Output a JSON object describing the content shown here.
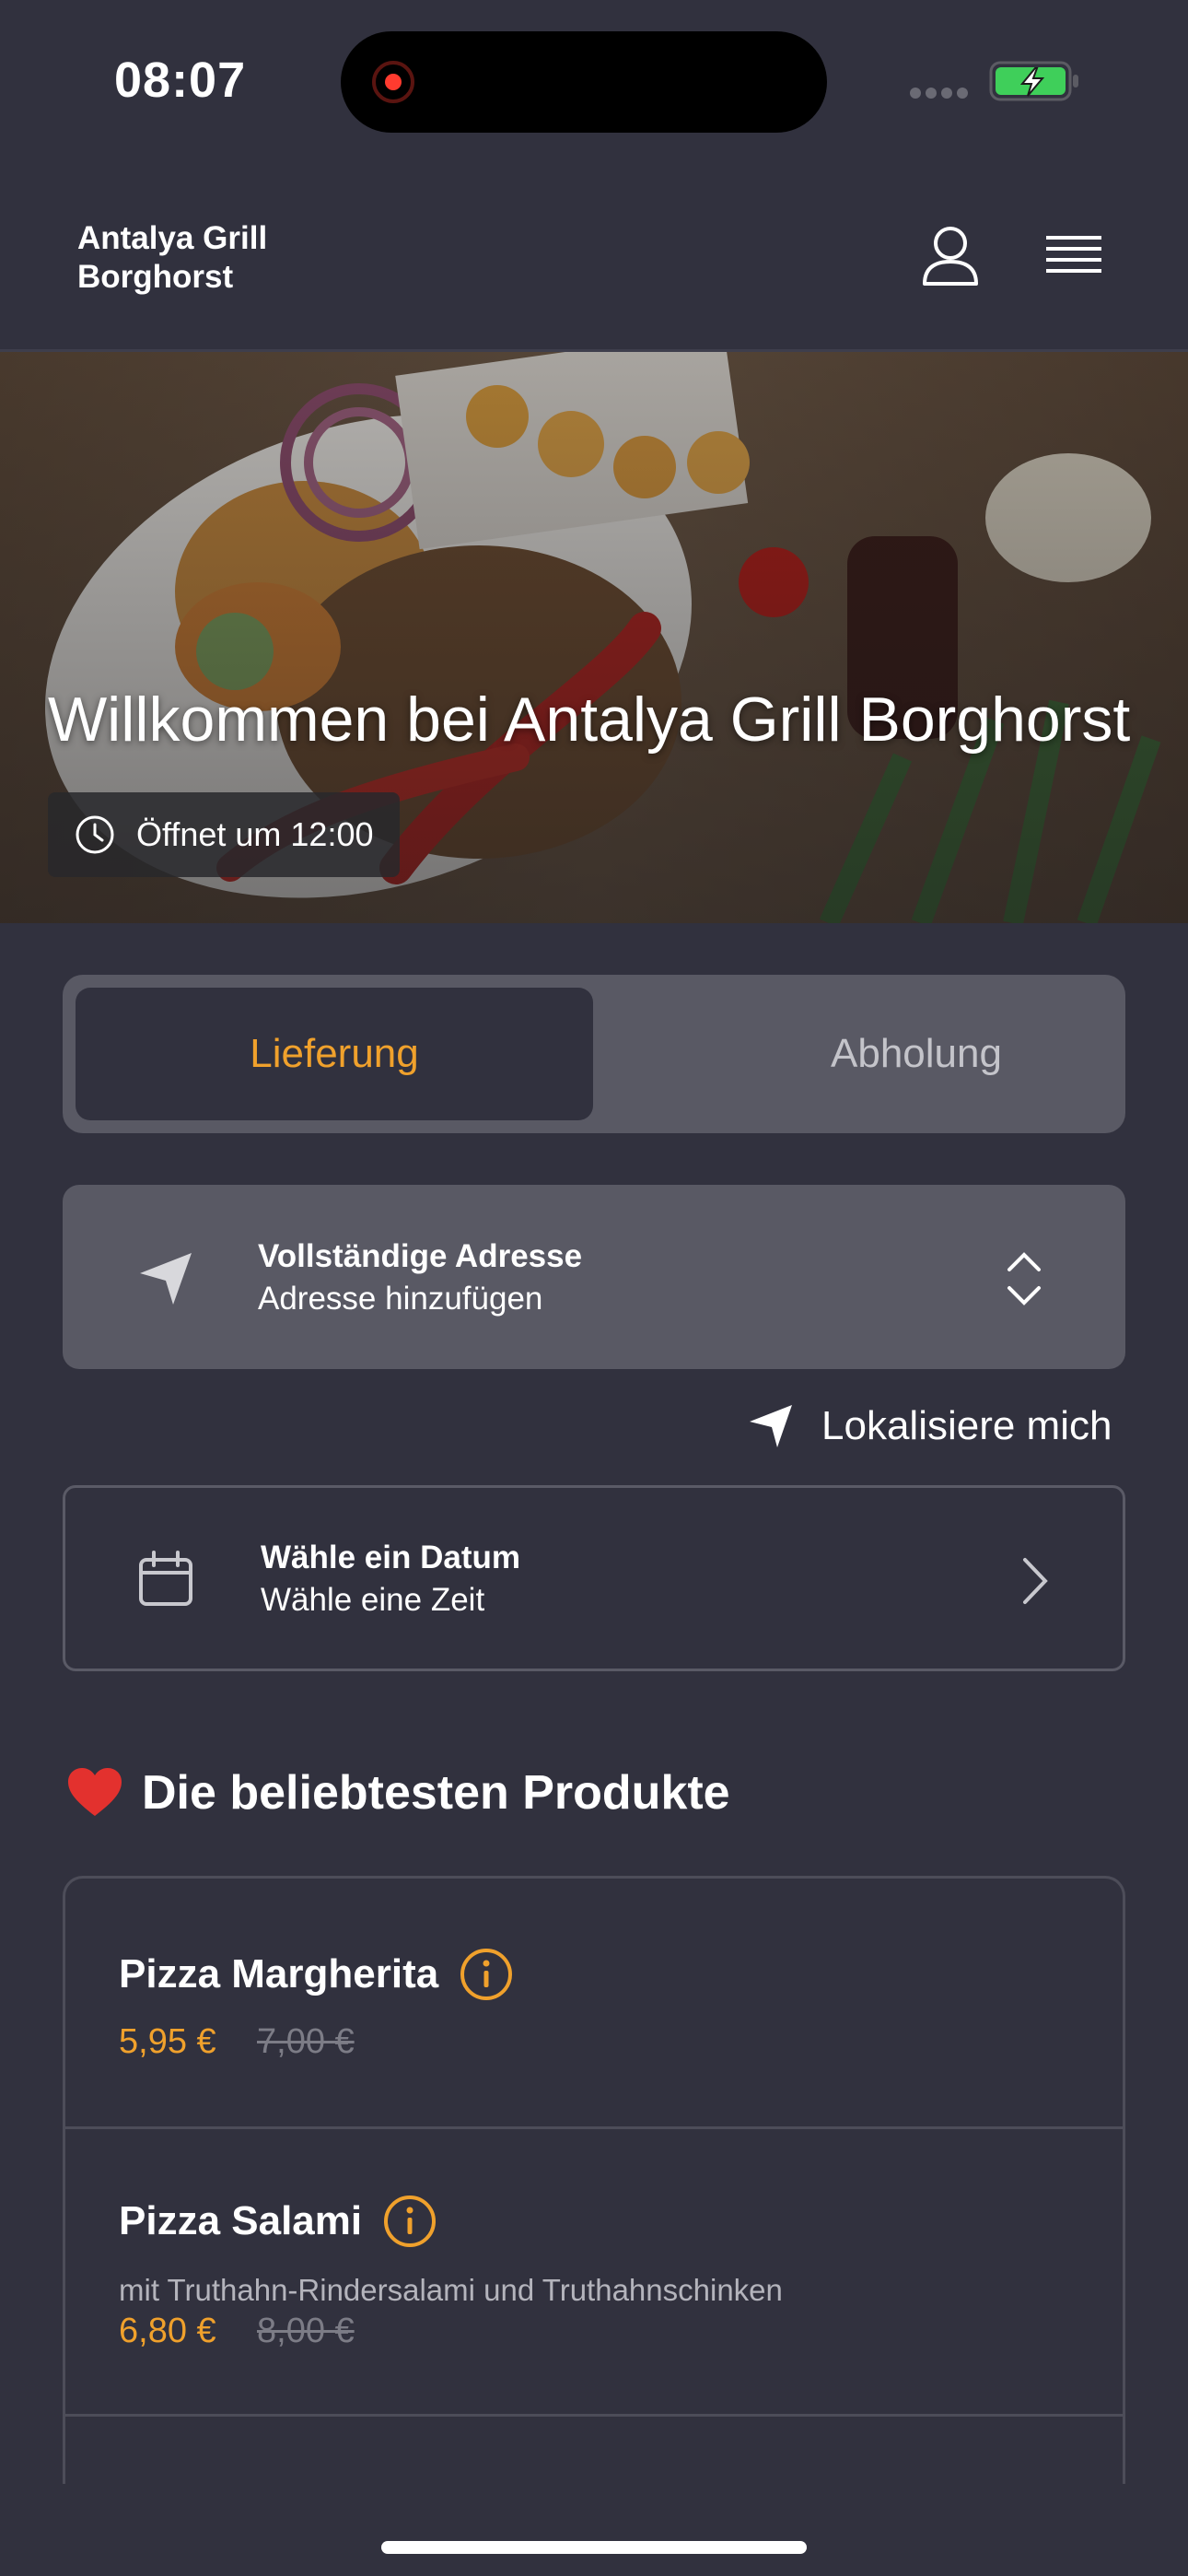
{
  "status_bar": {
    "time": "08:07"
  },
  "header": {
    "brand_line1": "Antalya Grill",
    "brand_line2": "Borghorst"
  },
  "hero": {
    "title": "Willkommen bei Antalya Grill Borghorst",
    "hours": "Öffnet um 12:00"
  },
  "order_mode": {
    "delivery": "Lieferung",
    "pickup": "Abholung",
    "selected": "Lieferung"
  },
  "address": {
    "title": "Vollständige Adresse",
    "subtitle": "Adresse hinzufügen"
  },
  "locate": {
    "label": "Lokalisiere mich"
  },
  "date": {
    "title": "Wähle ein Datum",
    "subtitle": "Wähle eine Zeit"
  },
  "popular": {
    "title": "Die beliebtesten Produkte",
    "items": [
      {
        "name": "Pizza Margherita",
        "description": "",
        "price": "5,95 €",
        "old_price": "7,00 €"
      },
      {
        "name": "Pizza Salami",
        "description": "mit Truthahn-Rindersalami und Truthahnschinken",
        "price": "6,80 €",
        "old_price": "8,00 €"
      }
    ]
  },
  "colors": {
    "background": "#31313e",
    "accent": "#f0a12c",
    "panel": "#595964"
  }
}
